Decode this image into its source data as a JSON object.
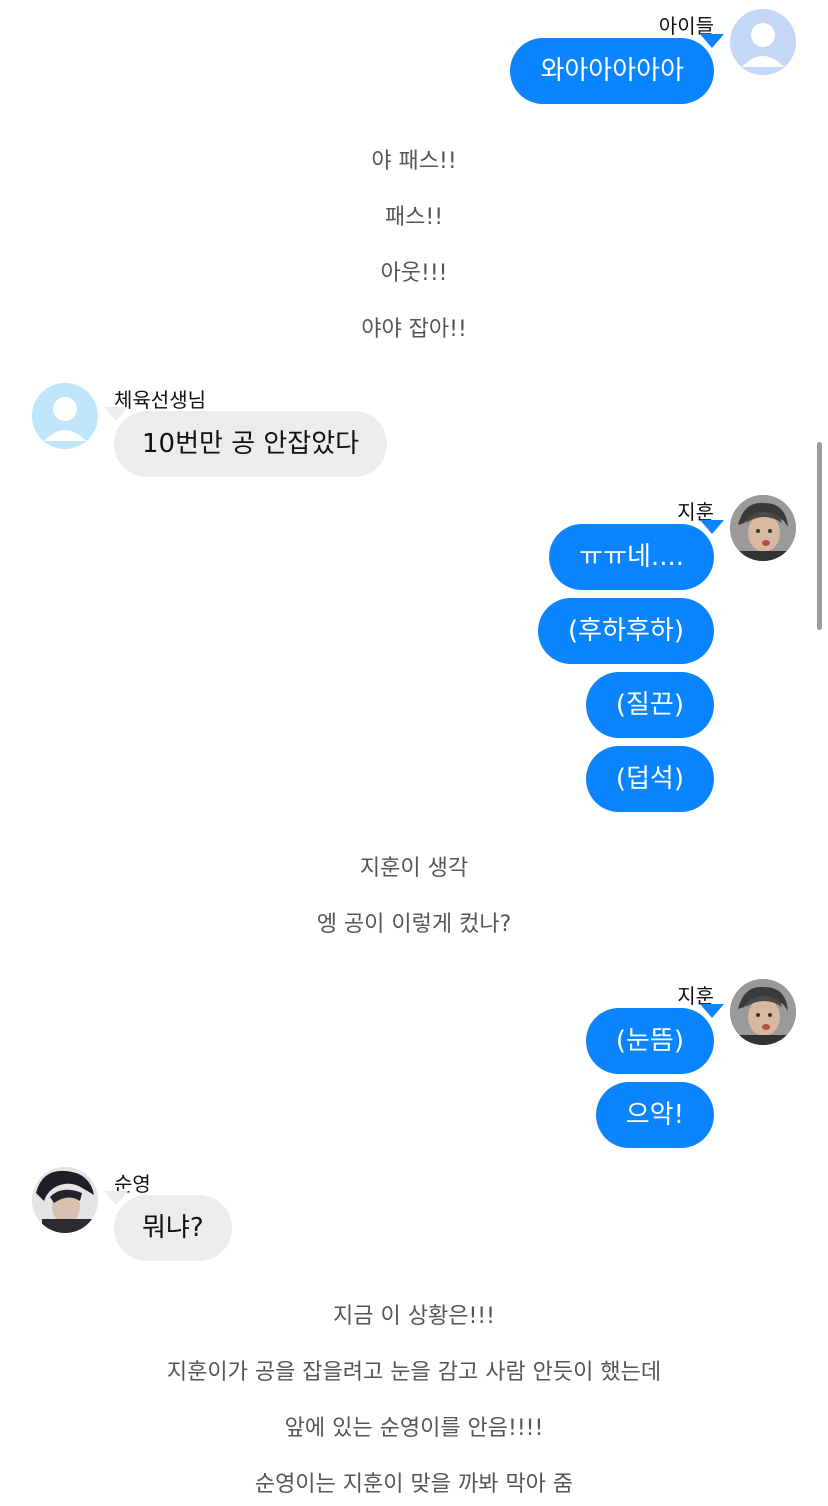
{
  "messages": {
    "m1": {
      "sender": "아이들",
      "bubbles": [
        "와아아아아아"
      ],
      "avatar": "generic-user-icon",
      "color": "#c4d7f7"
    },
    "m2": {
      "sender": "체육선생님",
      "bubbles": [
        "10번만 공 안잡았다"
      ],
      "avatar": "generic-user-icon",
      "color": "#bfe6fb"
    },
    "m3": {
      "sender": "지훈",
      "bubbles": [
        "ㅠㅠ네....",
        "(후하후하)",
        "(질끈)",
        "(덥석)"
      ],
      "avatar": "profile-photo-jihoon"
    },
    "m4": {
      "sender": "지훈",
      "bubbles": [
        "(눈뜸)",
        "으악!"
      ],
      "avatar": "profile-photo-jihoon"
    },
    "m5": {
      "sender": "순영",
      "bubbles": [
        "뭐냐?"
      ],
      "avatar": "profile-photo-soonyoung"
    }
  },
  "narration": {
    "n1": [
      "야 패스!!",
      "패스!!",
      "아웃!!!",
      "야야 잡아!!"
    ],
    "n2": [
      "지훈이 생각",
      "엥 공이 이렇게 컸나?"
    ],
    "n3": [
      "지금 이 상황은!!!",
      "지훈이가 공을 잡을려고 눈을 감고 사람 안듯이 했는데",
      "앞에 있는 순영이를 안음!!!!",
      "순영이는 지훈이 맞을 까봐 막아 줌"
    ]
  },
  "colors": {
    "sent_bubble": "#0a84ff",
    "received_bubble": "#ececec",
    "narration_text": "#555555"
  }
}
